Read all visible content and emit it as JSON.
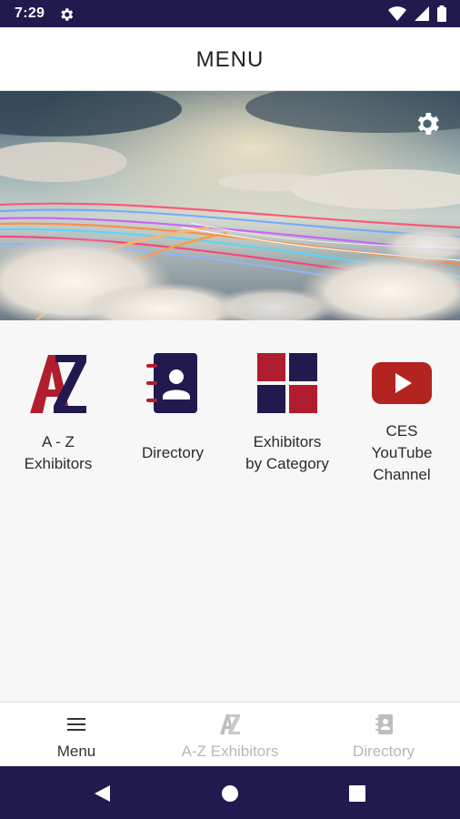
{
  "status_bar": {
    "time": "7:29",
    "icons": [
      "settings-icon",
      "wifi-icon",
      "signal-icon",
      "battery-icon"
    ]
  },
  "app_bar": {
    "title": "MENU"
  },
  "hero": {
    "settings_icon": "gear-icon"
  },
  "tiles": [
    {
      "label": "A - Z\nExhibitors",
      "icon": "az-logo-icon"
    },
    {
      "label": "Directory",
      "icon": "contact-book-icon"
    },
    {
      "label": "Exhibitors\nby Category",
      "icon": "category-grid-icon"
    },
    {
      "label": "CES\nYouTube\nChannel",
      "icon": "youtube-icon"
    }
  ],
  "bottom_nav": {
    "items": [
      {
        "label": "Menu",
        "icon": "hamburger-icon",
        "active": true
      },
      {
        "label": "A-Z Exhibitors",
        "icon": "az-icon",
        "active": false
      },
      {
        "label": "Directory",
        "icon": "contact-book-icon",
        "active": false
      }
    ]
  },
  "system_nav": {
    "buttons": [
      "back-icon",
      "home-icon",
      "recents-icon"
    ]
  },
  "colors": {
    "status_bar": "#211a4f",
    "brand_red": "#b01e2d",
    "brand_navy": "#211a4f",
    "youtube_red": "#b3231f",
    "nav_active": "#333333",
    "nav_inactive": "#b7b7b7"
  }
}
